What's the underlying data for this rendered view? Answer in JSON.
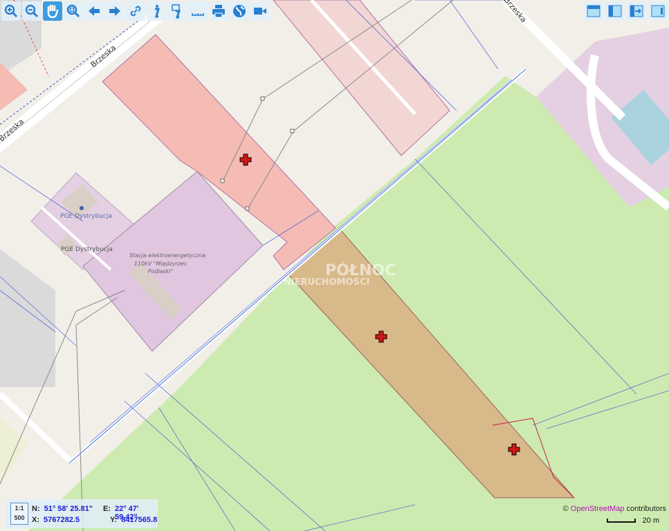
{
  "toolbar": {
    "left": [
      {
        "icon": "zoom-in-icon"
      },
      {
        "icon": "zoom-out-icon"
      },
      {
        "icon": "pan-hand-icon",
        "active": true
      },
      {
        "icon": "zoom-extent-icon"
      },
      {
        "icon": "arrow-left-icon"
      },
      {
        "icon": "arrow-right-icon"
      },
      {
        "icon": "link-icon"
      },
      {
        "icon": "info-icon"
      },
      {
        "icon": "info-document-icon"
      },
      {
        "icon": "ruler-icon"
      },
      {
        "icon": "print-icon"
      },
      {
        "icon": "globe-icon"
      },
      {
        "icon": "video-icon"
      }
    ],
    "right": [
      {
        "icon": "layout-top-panel-icon"
      },
      {
        "icon": "layout-left-panel-icon"
      },
      {
        "icon": "layout-export-icon"
      },
      {
        "icon": "layout-right-panel-icon"
      }
    ]
  },
  "map_labels": {
    "street1": "Brzeska",
    "street2": "Brzeska",
    "street3": "Brzeska",
    "poi1": "PGE Dystrybucja",
    "poi2": "PGE Dystrybucja",
    "station_line1": "Stacja elektroenergetyczna",
    "station_line2": "110kV \"Międzyrzec",
    "station_line3": "Podlaski\"",
    "watermark_line1": "PÓŁNOC",
    "watermark_line2": "NIERUCHOMOŚCI"
  },
  "coordinates": {
    "scale_label": "1:1",
    "scale_value": "500",
    "n_label": "N:",
    "n_value": "51° 58' 25.81\"",
    "e_label": "E:",
    "e_value": "22° 47' 59.42\"",
    "x_label": "X:",
    "x_value": "5767282.5",
    "y_label": "Y:",
    "y_value": "8417565.8"
  },
  "attribution": {
    "prefix": "©",
    "link": "OpenStreetMap",
    "suffix": "contributors"
  },
  "scale_bar": {
    "label": "20 m"
  },
  "colors": {
    "accent": "#3a9de0",
    "parcel_red": "#f4bcb5",
    "parcel_selected": "#d8b98a",
    "grass": "#cdebb0",
    "industrial": "#e4c9e0"
  }
}
